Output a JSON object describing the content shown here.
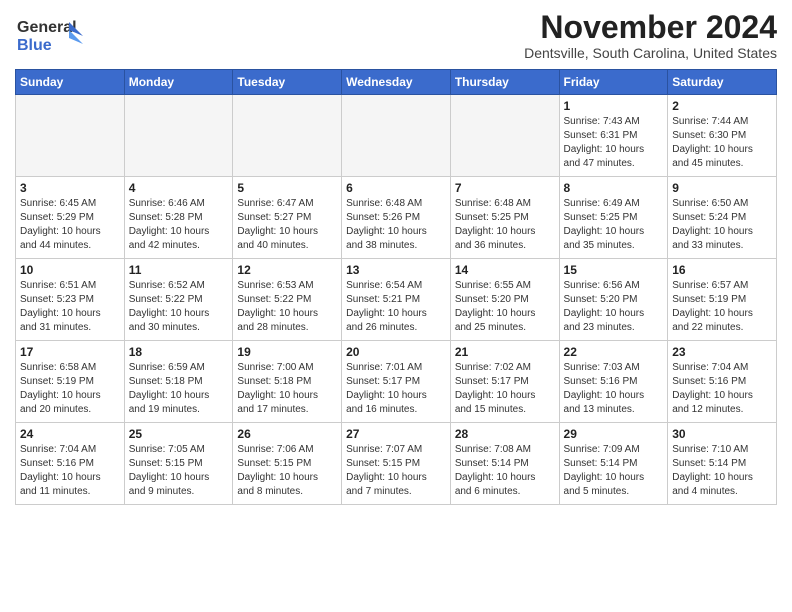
{
  "header": {
    "logo_line1": "General",
    "logo_line2": "Blue",
    "month": "November 2024",
    "location": "Dentsville, South Carolina, United States"
  },
  "weekdays": [
    "Sunday",
    "Monday",
    "Tuesday",
    "Wednesday",
    "Thursday",
    "Friday",
    "Saturday"
  ],
  "weeks": [
    [
      {
        "day": "",
        "info": ""
      },
      {
        "day": "",
        "info": ""
      },
      {
        "day": "",
        "info": ""
      },
      {
        "day": "",
        "info": ""
      },
      {
        "day": "",
        "info": ""
      },
      {
        "day": "1",
        "info": "Sunrise: 7:43 AM\nSunset: 6:31 PM\nDaylight: 10 hours and 47 minutes."
      },
      {
        "day": "2",
        "info": "Sunrise: 7:44 AM\nSunset: 6:30 PM\nDaylight: 10 hours and 45 minutes."
      }
    ],
    [
      {
        "day": "3",
        "info": "Sunrise: 6:45 AM\nSunset: 5:29 PM\nDaylight: 10 hours and 44 minutes."
      },
      {
        "day": "4",
        "info": "Sunrise: 6:46 AM\nSunset: 5:28 PM\nDaylight: 10 hours and 42 minutes."
      },
      {
        "day": "5",
        "info": "Sunrise: 6:47 AM\nSunset: 5:27 PM\nDaylight: 10 hours and 40 minutes."
      },
      {
        "day": "6",
        "info": "Sunrise: 6:48 AM\nSunset: 5:26 PM\nDaylight: 10 hours and 38 minutes."
      },
      {
        "day": "7",
        "info": "Sunrise: 6:48 AM\nSunset: 5:25 PM\nDaylight: 10 hours and 36 minutes."
      },
      {
        "day": "8",
        "info": "Sunrise: 6:49 AM\nSunset: 5:25 PM\nDaylight: 10 hours and 35 minutes."
      },
      {
        "day": "9",
        "info": "Sunrise: 6:50 AM\nSunset: 5:24 PM\nDaylight: 10 hours and 33 minutes."
      }
    ],
    [
      {
        "day": "10",
        "info": "Sunrise: 6:51 AM\nSunset: 5:23 PM\nDaylight: 10 hours and 31 minutes."
      },
      {
        "day": "11",
        "info": "Sunrise: 6:52 AM\nSunset: 5:22 PM\nDaylight: 10 hours and 30 minutes."
      },
      {
        "day": "12",
        "info": "Sunrise: 6:53 AM\nSunset: 5:22 PM\nDaylight: 10 hours and 28 minutes."
      },
      {
        "day": "13",
        "info": "Sunrise: 6:54 AM\nSunset: 5:21 PM\nDaylight: 10 hours and 26 minutes."
      },
      {
        "day": "14",
        "info": "Sunrise: 6:55 AM\nSunset: 5:20 PM\nDaylight: 10 hours and 25 minutes."
      },
      {
        "day": "15",
        "info": "Sunrise: 6:56 AM\nSunset: 5:20 PM\nDaylight: 10 hours and 23 minutes."
      },
      {
        "day": "16",
        "info": "Sunrise: 6:57 AM\nSunset: 5:19 PM\nDaylight: 10 hours and 22 minutes."
      }
    ],
    [
      {
        "day": "17",
        "info": "Sunrise: 6:58 AM\nSunset: 5:19 PM\nDaylight: 10 hours and 20 minutes."
      },
      {
        "day": "18",
        "info": "Sunrise: 6:59 AM\nSunset: 5:18 PM\nDaylight: 10 hours and 19 minutes."
      },
      {
        "day": "19",
        "info": "Sunrise: 7:00 AM\nSunset: 5:18 PM\nDaylight: 10 hours and 17 minutes."
      },
      {
        "day": "20",
        "info": "Sunrise: 7:01 AM\nSunset: 5:17 PM\nDaylight: 10 hours and 16 minutes."
      },
      {
        "day": "21",
        "info": "Sunrise: 7:02 AM\nSunset: 5:17 PM\nDaylight: 10 hours and 15 minutes."
      },
      {
        "day": "22",
        "info": "Sunrise: 7:03 AM\nSunset: 5:16 PM\nDaylight: 10 hours and 13 minutes."
      },
      {
        "day": "23",
        "info": "Sunrise: 7:04 AM\nSunset: 5:16 PM\nDaylight: 10 hours and 12 minutes."
      }
    ],
    [
      {
        "day": "24",
        "info": "Sunrise: 7:04 AM\nSunset: 5:16 PM\nDaylight: 10 hours and 11 minutes."
      },
      {
        "day": "25",
        "info": "Sunrise: 7:05 AM\nSunset: 5:15 PM\nDaylight: 10 hours and 9 minutes."
      },
      {
        "day": "26",
        "info": "Sunrise: 7:06 AM\nSunset: 5:15 PM\nDaylight: 10 hours and 8 minutes."
      },
      {
        "day": "27",
        "info": "Sunrise: 7:07 AM\nSunset: 5:15 PM\nDaylight: 10 hours and 7 minutes."
      },
      {
        "day": "28",
        "info": "Sunrise: 7:08 AM\nSunset: 5:14 PM\nDaylight: 10 hours and 6 minutes."
      },
      {
        "day": "29",
        "info": "Sunrise: 7:09 AM\nSunset: 5:14 PM\nDaylight: 10 hours and 5 minutes."
      },
      {
        "day": "30",
        "info": "Sunrise: 7:10 AM\nSunset: 5:14 PM\nDaylight: 10 hours and 4 minutes."
      }
    ]
  ]
}
